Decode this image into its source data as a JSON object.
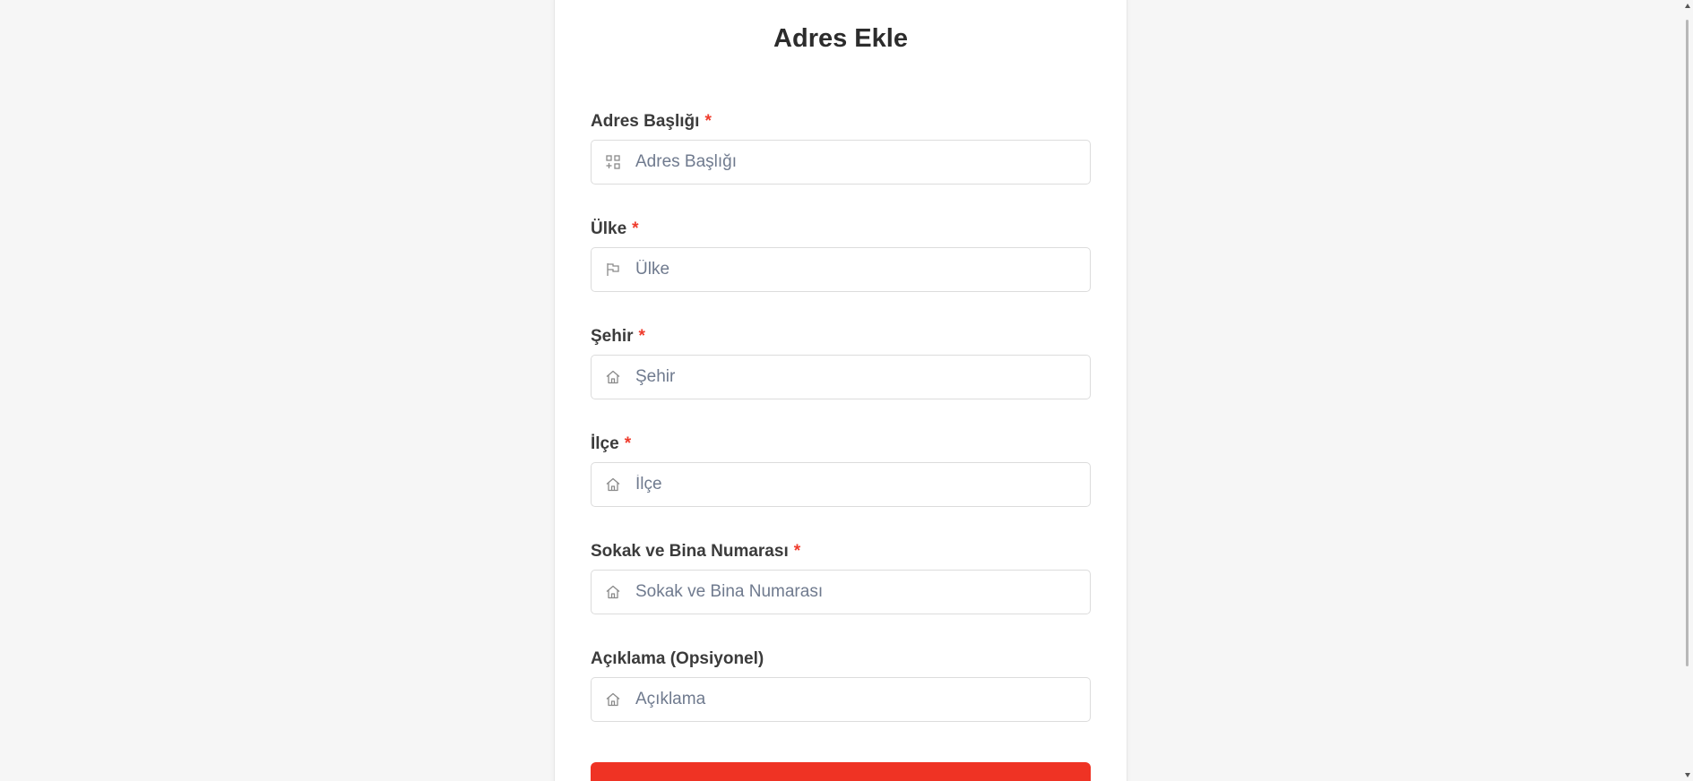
{
  "form": {
    "title": "Adres Ekle",
    "required_marker": "*",
    "fields": [
      {
        "label": "Adres Başlığı",
        "required": true,
        "placeholder": "Adres Başlığı",
        "value": "",
        "icon": "grid-plus-icon"
      },
      {
        "label": "Ülke",
        "required": true,
        "placeholder": "Ülke",
        "value": "",
        "icon": "flag-icon"
      },
      {
        "label": "Şehir",
        "required": true,
        "placeholder": "Şehir",
        "value": "",
        "icon": "home-icon"
      },
      {
        "label": "İlçe",
        "required": true,
        "placeholder": "İlçe",
        "value": "",
        "icon": "home-icon"
      },
      {
        "label": "Sokak ve Bina Numarası",
        "required": true,
        "placeholder": "Sokak ve Bina Numarası",
        "value": "",
        "icon": "home-icon"
      },
      {
        "label": "Açıklama (Opsiyonel)",
        "required": false,
        "placeholder": "Açıklama",
        "value": "",
        "icon": "home-icon"
      }
    ]
  },
  "colors": {
    "background": "#f6f6f6",
    "card": "#ffffff",
    "required": "#ef3b2c",
    "submit_button": "#ef3324",
    "placeholder": "#6f7a8e"
  }
}
